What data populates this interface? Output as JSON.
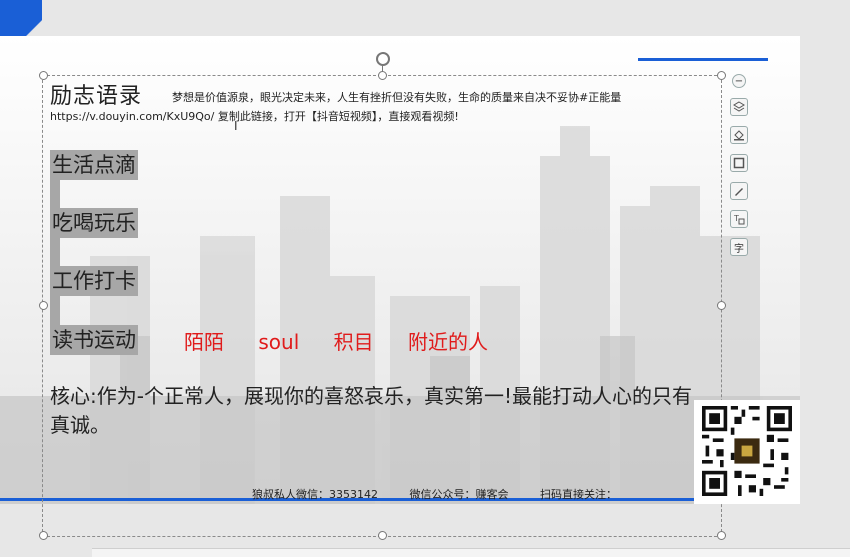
{
  "slide": {
    "title": "励志语录",
    "motto": "梦想是价值源泉，眼光决定未来，人生有挫折但没有失败，生命的质量来自决不妥协#正能量",
    "link": "https://v.douyin.com/KxU9Qo/ 复制此链接，打开【抖音短视频】，直接观看视频!",
    "categories": [
      "生活点滴",
      "吃喝玩乐",
      "工作打卡",
      "读书运动"
    ],
    "apps": [
      "陌陌",
      "soul",
      "积目",
      "附近的人"
    ],
    "core": "核心:作为-个正常人，展现你的喜怒哀乐，真实第一!最能打动人心的只有真诚。",
    "footer": [
      "狼叔私人微信：3353142",
      "微信公众号：赚客会",
      "扫码直接关注："
    ],
    "accent_color": "#1a5fd6",
    "app_color": "#e01b1b"
  },
  "toolbar": {
    "icons": [
      "minus-circle-icon",
      "layers-icon",
      "shape-fill-icon",
      "border-icon",
      "pen-icon",
      "text-box-icon",
      "font-icon"
    ],
    "font_label": "字"
  },
  "cursor": "I"
}
